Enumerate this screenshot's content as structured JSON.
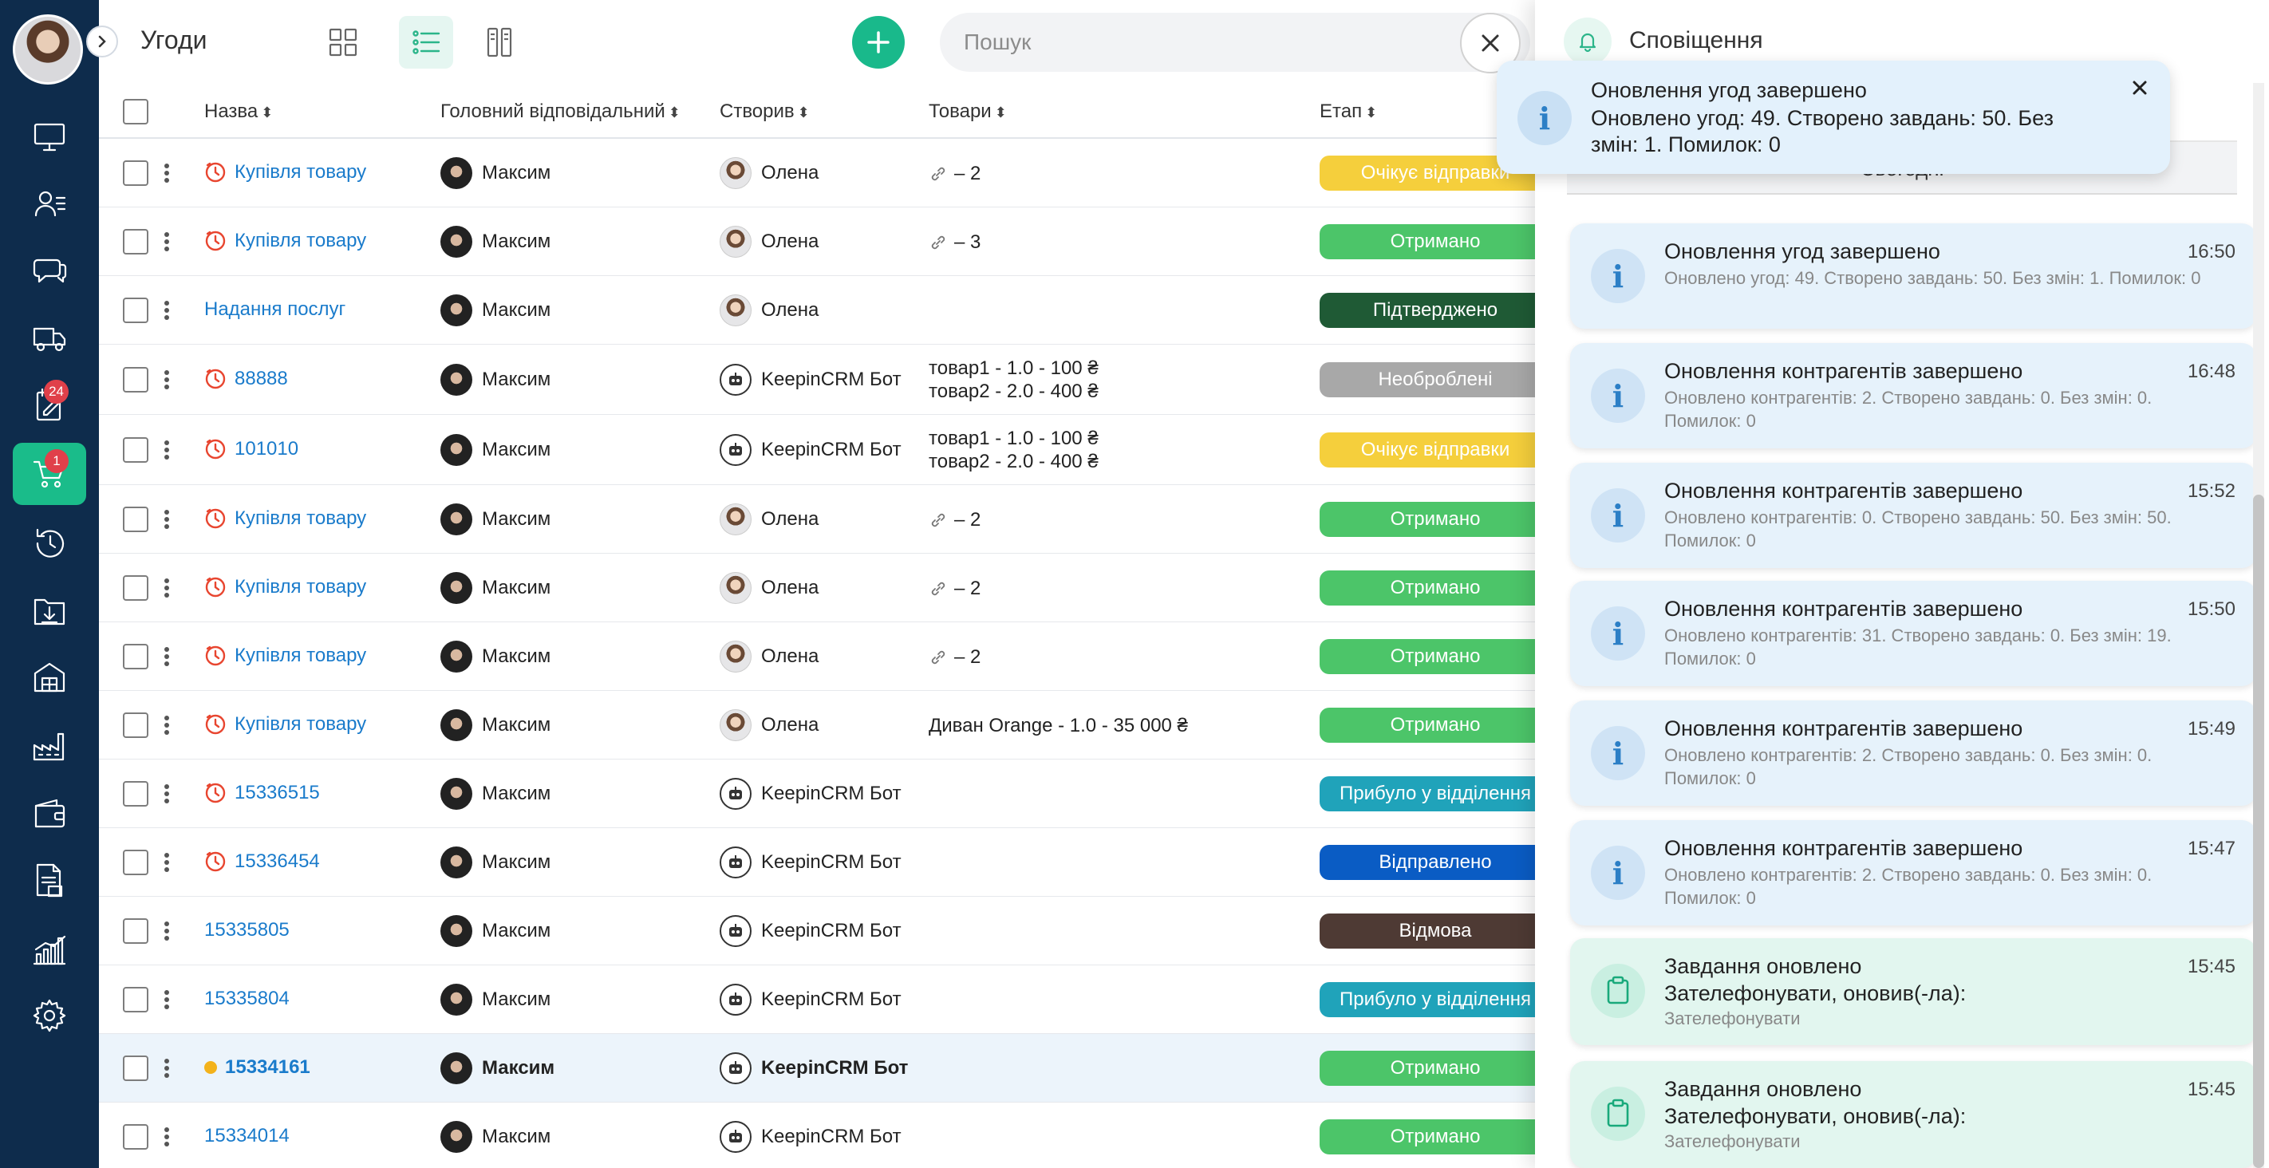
{
  "header": {
    "title": "Угоди",
    "search_placeholder": "Пошук"
  },
  "sidebar": {
    "items": [
      {
        "icon": "monitor-icon"
      },
      {
        "icon": "contacts-icon"
      },
      {
        "icon": "chat-icon"
      },
      {
        "icon": "truck-icon"
      },
      {
        "icon": "notepad-icon",
        "badge": "24"
      },
      {
        "icon": "cart-icon",
        "badge": "1",
        "active": true
      },
      {
        "icon": "history-icon"
      },
      {
        "icon": "folder-download-icon"
      },
      {
        "icon": "warehouse-icon"
      },
      {
        "icon": "factory-icon"
      },
      {
        "icon": "wallet-icon"
      },
      {
        "icon": "document-icon"
      },
      {
        "icon": "analytics-icon"
      },
      {
        "icon": "gear-icon"
      }
    ]
  },
  "table": {
    "columns": [
      "Назва",
      "Головний відповідальний",
      "Створив",
      "Товари",
      "Етап"
    ],
    "rows": [
      {
        "name": "Купівля товару",
        "clock": true,
        "responsible": "Максим",
        "creator": "Олена",
        "creator_bot": false,
        "goods_link": "– 2",
        "goods": [],
        "stage": "Очікує відправки",
        "stage_color": "#f5cf3c"
      },
      {
        "name": "Купівля товару",
        "clock": true,
        "responsible": "Максим",
        "creator": "Олена",
        "creator_bot": false,
        "goods_link": "– 3",
        "goods": [],
        "stage": "Отримано",
        "stage_color": "#4cc569"
      },
      {
        "name": "Надання послуг",
        "clock": false,
        "responsible": "Максим",
        "creator": "Олена",
        "creator_bot": false,
        "goods_link": "",
        "goods": [],
        "stage": "Підтверджено",
        "stage_color": "#1f5a35"
      },
      {
        "name": "88888",
        "clock": true,
        "responsible": "Максим",
        "creator": "KeepinCRM Бот",
        "creator_bot": true,
        "goods_link": "",
        "goods": [
          "товар1 - 1.0 - 100 ₴",
          "товар2 - 2.0 - 400 ₴"
        ],
        "stage": "Необроблені",
        "stage_color": "#a8a8a8"
      },
      {
        "name": "101010",
        "clock": true,
        "responsible": "Максим",
        "creator": "KeepinCRM Бот",
        "creator_bot": true,
        "goods_link": "",
        "goods": [
          "товар1 - 1.0 - 100 ₴",
          "товар2 - 2.0 - 400 ₴"
        ],
        "stage": "Очікує відправки",
        "stage_color": "#f5cf3c"
      },
      {
        "name": "Купівля товару",
        "clock": true,
        "responsible": "Максим",
        "creator": "Олена",
        "creator_bot": false,
        "goods_link": "– 2",
        "goods": [],
        "stage": "Отримано",
        "stage_color": "#4cc569"
      },
      {
        "name": "Купівля товару",
        "clock": true,
        "responsible": "Максим",
        "creator": "Олена",
        "creator_bot": false,
        "goods_link": "– 2",
        "goods": [],
        "stage": "Отримано",
        "stage_color": "#4cc569"
      },
      {
        "name": "Купівля товару",
        "clock": true,
        "responsible": "Максим",
        "creator": "Олена",
        "creator_bot": false,
        "goods_link": "– 2",
        "goods": [],
        "stage": "Отримано",
        "stage_color": "#4cc569"
      },
      {
        "name": "Купівля товару",
        "clock": true,
        "responsible": "Максим",
        "creator": "Олена",
        "creator_bot": false,
        "goods_link": "",
        "goods": [
          "Диван Orange - 1.0 - 35 000 ₴"
        ],
        "stage": "Отримано",
        "stage_color": "#4cc569"
      },
      {
        "name": "15336515",
        "clock": true,
        "responsible": "Максим",
        "creator": "KeepinCRM Бот",
        "creator_bot": true,
        "goods_link": "",
        "goods": [],
        "stage": "Прибуло у відділення",
        "stage_color": "#20a3ba"
      },
      {
        "name": "15336454",
        "clock": true,
        "responsible": "Максим",
        "creator": "KeepinCRM Бот",
        "creator_bot": true,
        "goods_link": "",
        "goods": [],
        "stage": "Відправлено",
        "stage_color": "#0a5cc4"
      },
      {
        "name": "15335805",
        "clock": false,
        "responsible": "Максим",
        "creator": "KeepinCRM Бот",
        "creator_bot": true,
        "goods_link": "",
        "goods": [],
        "stage": "Відмова",
        "stage_color": "#4e3a34"
      },
      {
        "name": "15335804",
        "clock": false,
        "responsible": "Максим",
        "creator": "KeepinCRM Бот",
        "creator_bot": true,
        "goods_link": "",
        "goods": [],
        "stage": "Прибуло у відділення",
        "stage_color": "#20a3ba"
      },
      {
        "name": "15334161",
        "clock": false,
        "unread": true,
        "highlighted": true,
        "responsible": "Максим",
        "creator": "KeepinCRM Бот",
        "creator_bot": true,
        "goods_link": "",
        "goods": [],
        "stage": "Отримано",
        "stage_color": "#4cc569"
      },
      {
        "name": "15334014",
        "clock": false,
        "responsible": "Максим",
        "creator": "KeepinCRM Бот",
        "creator_bot": true,
        "goods_link": "",
        "goods": [],
        "stage": "Отримано",
        "stage_color": "#4cc569"
      }
    ]
  },
  "notifications_panel": {
    "title": "Сповіщення",
    "today_label": "Сьогодні",
    "items": [
      {
        "type": "info",
        "title": "Оновлення угод завершено",
        "time": "16:50",
        "body": "Оновлено угод: 49. Створено завдань: 50. Без змін: 1. Помилок: 0"
      },
      {
        "type": "info",
        "title": "Оновлення контрагентів завершено",
        "time": "16:48",
        "body": "Оновлено контрагентів: 2. Створено завдань: 0. Без змін: 0. Помилок: 0"
      },
      {
        "type": "info",
        "title": "Оновлення контрагентів завершено",
        "time": "15:52",
        "body": "Оновлено контрагентів: 0. Створено завдань: 50. Без змін: 50. Помилок: 0"
      },
      {
        "type": "info",
        "title": "Оновлення контрагентів завершено",
        "time": "15:50",
        "body": "Оновлено контрагентів: 31. Створено завдань: 0. Без змін: 19. Помилок: 0"
      },
      {
        "type": "info",
        "title": "Оновлення контрагентів завершено",
        "time": "15:49",
        "body": "Оновлено контрагентів: 2. Створено завдань: 0. Без змін: 0. Помилок: 0"
      },
      {
        "type": "info",
        "title": "Оновлення контрагентів завершено",
        "time": "15:47",
        "body": "Оновлено контрагентів: 2. Створено завдань: 0. Без змін: 0. Помилок: 0"
      },
      {
        "type": "task",
        "title": "Завдання оновлено",
        "time": "15:45",
        "subtitle": "Зателефонувати, оновив(-ла):",
        "body": "Зателефонувати"
      },
      {
        "type": "task",
        "title": "Завдання оновлено",
        "time": "15:45",
        "subtitle": "Зателефонувати, оновив(-ла):",
        "body": "Зателефонувати"
      }
    ]
  },
  "toast": {
    "title": "Оновлення угод завершено",
    "body": "Оновлено угод: 49. Створено завдань: 50. Без змін: 1. Помилок: 0"
  }
}
